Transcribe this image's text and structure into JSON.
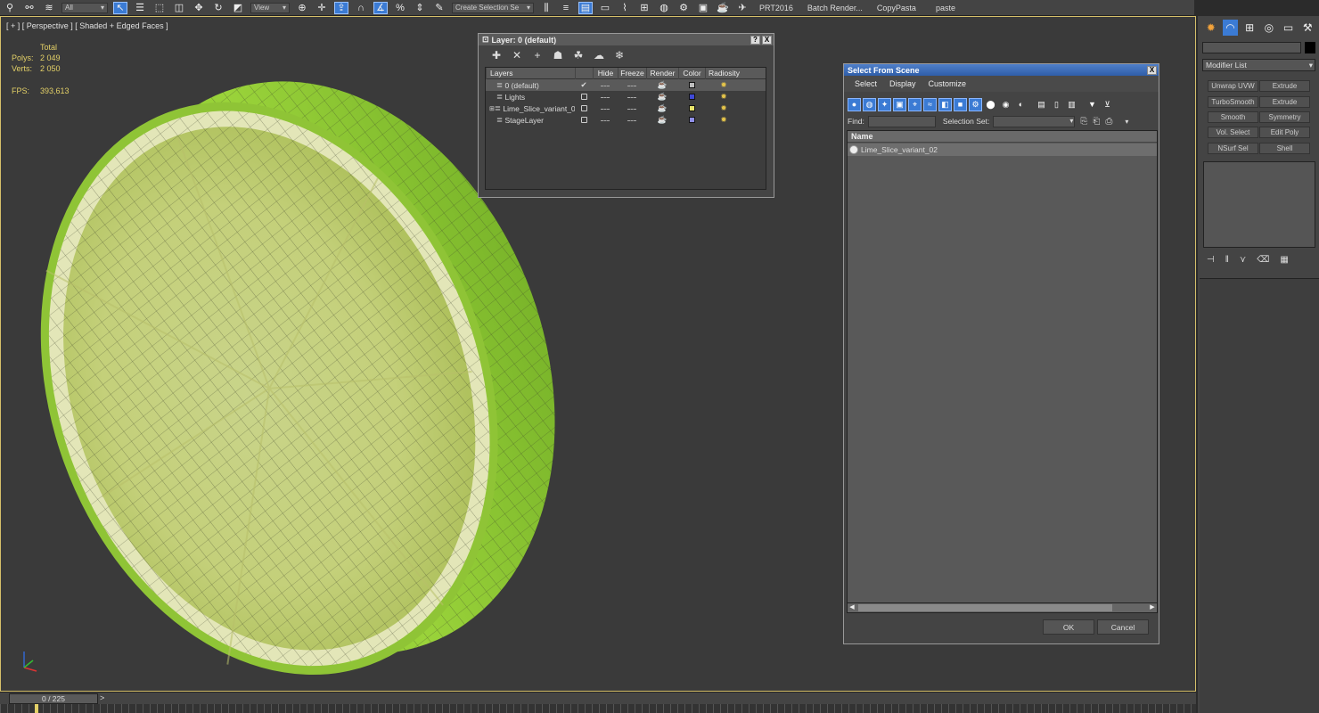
{
  "toolbar": {
    "filter_dropdown": "All",
    "view_dropdown": "View",
    "selection_set_dropdown": "Create Selection Se",
    "custom_buttons": [
      "PRT2016",
      "Batch Render...",
      "CopyPasta",
      "paste"
    ]
  },
  "viewport": {
    "label": "[ + ] [ Perspective ] [ Shaded + Edged Faces ]",
    "stats": {
      "header": "Total",
      "polys_label": "Polys:",
      "polys_value": "2 049",
      "verts_label": "Verts:",
      "verts_value": "2 050",
      "fps_label": "FPS:",
      "fps_value": "393,613"
    }
  },
  "layer_dialog": {
    "title": "Layer: 0 (default)",
    "help_btn": "?",
    "close_btn": "X",
    "columns": [
      "Layers",
      "Hide",
      "Freeze",
      "Render",
      "Color",
      "Radiosity"
    ],
    "layers": [
      {
        "name": "0 (default)",
        "current": true,
        "color": "#bdbdbd"
      },
      {
        "name": "Lights",
        "current": false,
        "color": "#3f49d6"
      },
      {
        "name": "Lime_Slice_variant_0",
        "current": false,
        "color": "#e8e46a"
      },
      {
        "name": "StageLayer",
        "current": false,
        "color": "#8f8fe8"
      }
    ]
  },
  "select_from_scene": {
    "title": "Select From Scene",
    "close_btn": "X",
    "menu": [
      "Select",
      "Display",
      "Customize"
    ],
    "find_label": "Find:",
    "selection_set_label": "Selection Set:",
    "list_header": "Name",
    "items": [
      "Lime_Slice_variant_02"
    ],
    "ok_label": "OK",
    "cancel_label": "Cancel"
  },
  "command_panel": {
    "modifier_list": "Modifier List",
    "modifier_buttons": [
      "Unwrap UVW",
      "Extrude",
      "TurboSmooth",
      "Extrude",
      "Smooth",
      "Symmetry",
      "Vol. Select",
      "Edit Poly",
      "NSurf Sel",
      "Shell"
    ]
  },
  "time_slider": {
    "frame_label": "0 / 225",
    "next_arrow": ">",
    "current_frame": 0,
    "total_frames": 225
  },
  "colors": {
    "accent": "#3b7bd4",
    "stats_text": "#e3d067",
    "lime_rind": "#8fcb2c",
    "lime_flesh": "#cfd98a"
  }
}
